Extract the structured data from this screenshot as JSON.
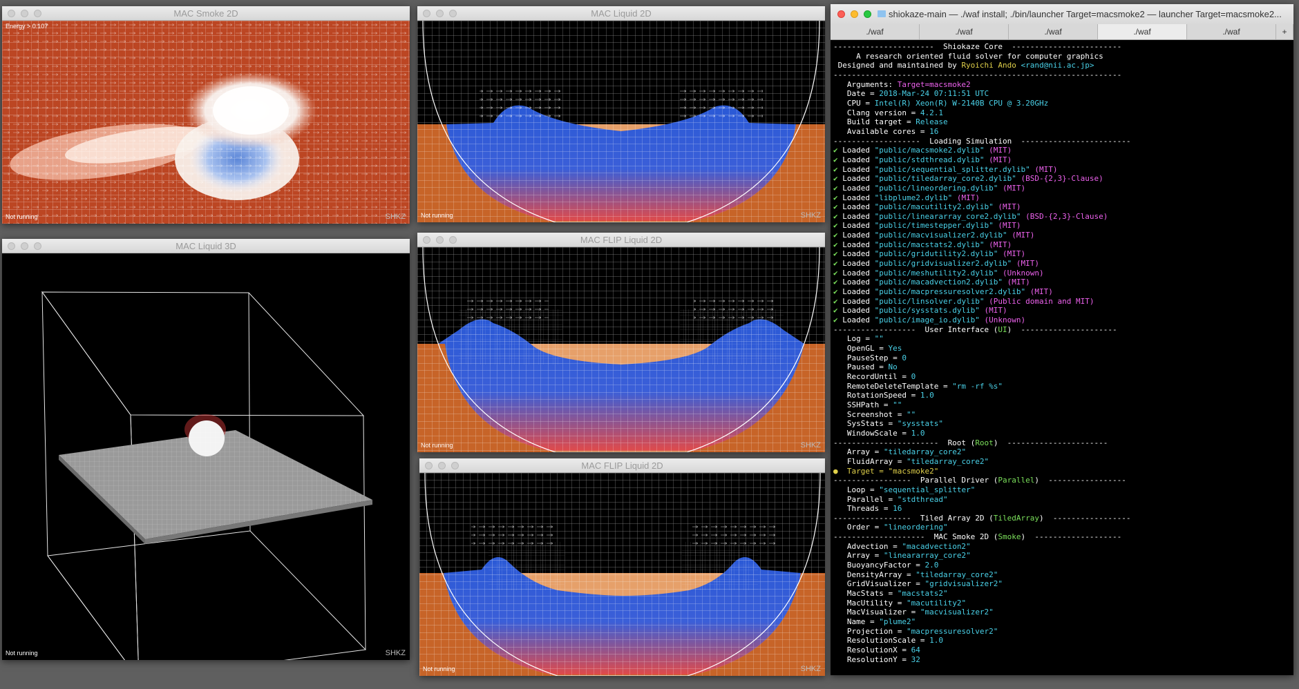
{
  "windows": {
    "smoke2d": {
      "title": "MAC Smoke 2D",
      "energy": "Energy > 0.107",
      "status": "Not running",
      "logo": "SHKZ"
    },
    "liquid2d": {
      "title": "MAC Liquid 2D",
      "status": "Not running",
      "logo": "SHKZ"
    },
    "liquid3d": {
      "title": "MAC Liquid 3D",
      "status": "Not running",
      "logo": "SHKZ"
    },
    "flip1": {
      "title": "MAC FLIP Liquid 2D",
      "status": "Not running",
      "logo": "SHKZ"
    },
    "flip2": {
      "title": "MAC FLIP Liquid 2D",
      "status": "Not running",
      "logo": "SHKZ"
    }
  },
  "terminal": {
    "title": "shiokaze-main — ./waf install; ./bin/launcher Target=macsmoke2 — launcher Target=macsmoke2...",
    "tabs": [
      "./waf",
      "./waf",
      "./waf",
      "./waf",
      "./waf"
    ],
    "new_tab": "+",
    "lines": [
      [
        [
          "w",
          "----------------------  Shiokaze Core  ------------------------"
        ]
      ],
      [
        [
          "w",
          "     A research oriented fluid solver for computer graphics"
        ]
      ],
      [
        [
          "w",
          " Designed and maintained by "
        ],
        [
          "y",
          "Ryoichi Ando"
        ],
        [
          "w",
          " "
        ],
        [
          "c",
          "<rand@nii.ac.jp>"
        ]
      ],
      [
        [
          "w",
          "---------------------------------------------------------------"
        ]
      ],
      [
        [
          "w",
          "   Arguments: "
        ],
        [
          "m",
          "Target=macsmoke2"
        ]
      ],
      [
        [
          "w",
          "   Date = "
        ],
        [
          "c",
          "2018-Mar-24 07:11:51 UTC"
        ]
      ],
      [
        [
          "w",
          "   CPU = "
        ],
        [
          "c",
          "Intel(R) Xeon(R) W-2140B CPU @ 3.20GHz"
        ]
      ],
      [
        [
          "w",
          "   Clang version = "
        ],
        [
          "c",
          "4.2.1"
        ]
      ],
      [
        [
          "w",
          "   Build target = "
        ],
        [
          "c",
          "Release"
        ]
      ],
      [
        [
          "w",
          "   Available cores = "
        ],
        [
          "c",
          "16"
        ]
      ],
      [
        [
          "w",
          "-------------------  Loading Simulation  ------------------------"
        ]
      ],
      [
        [
          "g",
          "✔"
        ],
        [
          "w",
          " Loaded "
        ],
        [
          "c",
          "\"public/macsmoke2.dylib\""
        ],
        [
          "m",
          " (MIT)"
        ]
      ],
      [
        [
          "g",
          "✔"
        ],
        [
          "w",
          " Loaded "
        ],
        [
          "c",
          "\"public/stdthread.dylib\""
        ],
        [
          "m",
          " (MIT)"
        ]
      ],
      [
        [
          "g",
          "✔"
        ],
        [
          "w",
          " Loaded "
        ],
        [
          "c",
          "\"public/sequential_splitter.dylib\""
        ],
        [
          "m",
          " (MIT)"
        ]
      ],
      [
        [
          "g",
          "✔"
        ],
        [
          "w",
          " Loaded "
        ],
        [
          "c",
          "\"public/tiledarray_core2.dylib\""
        ],
        [
          "m",
          " (BSD-{2,3}-Clause)"
        ]
      ],
      [
        [
          "g",
          "✔"
        ],
        [
          "w",
          " Loaded "
        ],
        [
          "c",
          "\"public/lineordering.dylib\""
        ],
        [
          "m",
          " (MIT)"
        ]
      ],
      [
        [
          "g",
          "✔"
        ],
        [
          "w",
          " Loaded "
        ],
        [
          "c",
          "\"libplume2.dylib\""
        ],
        [
          "m",
          " (MIT)"
        ]
      ],
      [
        [
          "g",
          "✔"
        ],
        [
          "w",
          " Loaded "
        ],
        [
          "c",
          "\"public/macutility2.dylib\""
        ],
        [
          "m",
          " (MIT)"
        ]
      ],
      [
        [
          "g",
          "✔"
        ],
        [
          "w",
          " Loaded "
        ],
        [
          "c",
          "\"public/lineararray_core2.dylib\""
        ],
        [
          "m",
          " (BSD-{2,3}-Clause)"
        ]
      ],
      [
        [
          "g",
          "✔"
        ],
        [
          "w",
          " Loaded "
        ],
        [
          "c",
          "\"public/timestepper.dylib\""
        ],
        [
          "m",
          " (MIT)"
        ]
      ],
      [
        [
          "g",
          "✔"
        ],
        [
          "w",
          " Loaded "
        ],
        [
          "c",
          "\"public/macvisualizer2.dylib\""
        ],
        [
          "m",
          " (MIT)"
        ]
      ],
      [
        [
          "g",
          "✔"
        ],
        [
          "w",
          " Loaded "
        ],
        [
          "c",
          "\"public/macstats2.dylib\""
        ],
        [
          "m",
          " (MIT)"
        ]
      ],
      [
        [
          "g",
          "✔"
        ],
        [
          "w",
          " Loaded "
        ],
        [
          "c",
          "\"public/gridutility2.dylib\""
        ],
        [
          "m",
          " (MIT)"
        ]
      ],
      [
        [
          "g",
          "✔"
        ],
        [
          "w",
          " Loaded "
        ],
        [
          "c",
          "\"public/gridvisualizer2.dylib\""
        ],
        [
          "m",
          " (MIT)"
        ]
      ],
      [
        [
          "g",
          "✔"
        ],
        [
          "w",
          " Loaded "
        ],
        [
          "c",
          "\"public/meshutility2.dylib\""
        ],
        [
          "m",
          " (Unknown)"
        ]
      ],
      [
        [
          "g",
          "✔"
        ],
        [
          "w",
          " Loaded "
        ],
        [
          "c",
          "\"public/macadvection2.dylib\""
        ],
        [
          "m",
          " (MIT)"
        ]
      ],
      [
        [
          "g",
          "✔"
        ],
        [
          "w",
          " Loaded "
        ],
        [
          "c",
          "\"public/macpressuresolver2.dylib\""
        ],
        [
          "m",
          " (MIT)"
        ]
      ],
      [
        [
          "g",
          "✔"
        ],
        [
          "w",
          " Loaded "
        ],
        [
          "c",
          "\"public/linsolver.dylib\""
        ],
        [
          "m",
          " (Public domain and MIT)"
        ]
      ],
      [
        [
          "g",
          "✔"
        ],
        [
          "w",
          " Loaded "
        ],
        [
          "c",
          "\"public/sysstats.dylib\""
        ],
        [
          "m",
          " (MIT)"
        ]
      ],
      [
        [
          "g",
          "✔"
        ],
        [
          "w",
          " Loaded "
        ],
        [
          "c",
          "\"public/image_io.dylib\""
        ],
        [
          "m",
          " (Unknown)"
        ]
      ],
      [
        [
          "w",
          "------------------  User Interface ("
        ],
        [
          "g",
          "UI"
        ],
        [
          "w",
          ")  ---------------------"
        ]
      ],
      [
        [
          "w",
          "   Log = "
        ],
        [
          "c",
          "\"\""
        ]
      ],
      [
        [
          "w",
          "   OpenGL = "
        ],
        [
          "c",
          "Yes"
        ]
      ],
      [
        [
          "w",
          "   PauseStep = "
        ],
        [
          "c",
          "0"
        ]
      ],
      [
        [
          "w",
          "   Paused = "
        ],
        [
          "c",
          "No"
        ]
      ],
      [
        [
          "w",
          "   RecordUntil = "
        ],
        [
          "c",
          "0"
        ]
      ],
      [
        [
          "w",
          "   RemoteDeleteTemplate = "
        ],
        [
          "c",
          "\"rm -rf %s\""
        ]
      ],
      [
        [
          "w",
          "   RotationSpeed = "
        ],
        [
          "c",
          "1.0"
        ]
      ],
      [
        [
          "w",
          "   SSHPath = "
        ],
        [
          "c",
          "\"\""
        ]
      ],
      [
        [
          "w",
          "   Screenshot = "
        ],
        [
          "c",
          "\"\""
        ]
      ],
      [
        [
          "w",
          "   SysStats = "
        ],
        [
          "c",
          "\"sysstats\""
        ]
      ],
      [
        [
          "w",
          "   WindowScale = "
        ],
        [
          "c",
          "1.0"
        ]
      ],
      [
        [
          "w",
          "-----------------------  Root ("
        ],
        [
          "g",
          "Root"
        ],
        [
          "w",
          ")  ----------------------"
        ]
      ],
      [
        [
          "w",
          "   Array = "
        ],
        [
          "c",
          "\"tiledarray_core2\""
        ]
      ],
      [
        [
          "w",
          "   FluidArray = "
        ],
        [
          "c",
          "\"tiledarray_core2\""
        ]
      ],
      [
        [
          "yd",
          "●"
        ],
        [
          "y",
          "  Target = \"macsmoke2\""
        ]
      ],
      [
        [
          "w",
          "-----------------  Parallel Driver ("
        ],
        [
          "g",
          "Parallel"
        ],
        [
          "w",
          ")  -----------------"
        ]
      ],
      [
        [
          "w",
          "   Loop = "
        ],
        [
          "c",
          "\"sequential_splitter\""
        ]
      ],
      [
        [
          "w",
          "   Parallel = "
        ],
        [
          "c",
          "\"stdthread\""
        ]
      ],
      [
        [
          "w",
          "   Threads = "
        ],
        [
          "c",
          "16"
        ]
      ],
      [
        [
          "w",
          "-----------------  Tiled Array 2D ("
        ],
        [
          "g",
          "TiledArray"
        ],
        [
          "w",
          ")  -----------------"
        ]
      ],
      [
        [
          "w",
          "   Order = "
        ],
        [
          "c",
          "\"lineordering\""
        ]
      ],
      [
        [
          "w",
          "--------------------  MAC Smoke 2D ("
        ],
        [
          "g",
          "Smoke"
        ],
        [
          "w",
          ")  -------------------"
        ]
      ],
      [
        [
          "w",
          "   Advection = "
        ],
        [
          "c",
          "\"macadvection2\""
        ]
      ],
      [
        [
          "w",
          "   Array = "
        ],
        [
          "c",
          "\"lineararray_core2\""
        ]
      ],
      [
        [
          "w",
          "   BuoyancyFactor = "
        ],
        [
          "c",
          "2.0"
        ]
      ],
      [
        [
          "w",
          "   DensityArray = "
        ],
        [
          "c",
          "\"tiledarray_core2\""
        ]
      ],
      [
        [
          "w",
          "   GridVisualizer = "
        ],
        [
          "c",
          "\"gridvisualizer2\""
        ]
      ],
      [
        [
          "w",
          "   MacStats = "
        ],
        [
          "c",
          "\"macstats2\""
        ]
      ],
      [
        [
          "w",
          "   MacUtility = "
        ],
        [
          "c",
          "\"macutility2\""
        ]
      ],
      [
        [
          "w",
          "   MacVisualizer = "
        ],
        [
          "c",
          "\"macvisualizer2\""
        ]
      ],
      [
        [
          "w",
          "   Name = "
        ],
        [
          "c",
          "\"plume2\""
        ]
      ],
      [
        [
          "w",
          "   Projection = "
        ],
        [
          "c",
          "\"macpressuresolver2\""
        ]
      ],
      [
        [
          "w",
          "   ResolutionScale = "
        ],
        [
          "c",
          "1.0"
        ]
      ],
      [
        [
          "w",
          "   ResolutionX = "
        ],
        [
          "c",
          "64"
        ]
      ],
      [
        [
          "w",
          "   ResolutionY = "
        ],
        [
          "c",
          "32"
        ]
      ]
    ]
  }
}
